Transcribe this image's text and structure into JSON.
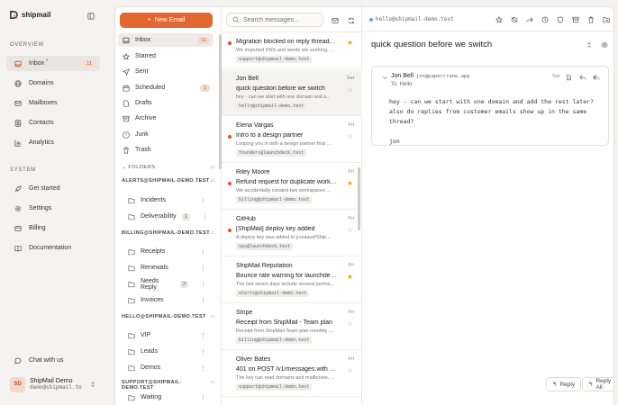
{
  "app": {
    "name": "shipmail"
  },
  "nav": {
    "overview_label": "OVERVIEW",
    "items": [
      {
        "label": "Inbox",
        "badge": "11",
        "dot": "•"
      },
      {
        "label": "Domains"
      },
      {
        "label": "Mailboxes"
      },
      {
        "label": "Contacts"
      },
      {
        "label": "Analytics"
      }
    ],
    "system_label": "SYSTEM",
    "system_items": [
      {
        "label": "Get started"
      },
      {
        "label": "Settings"
      },
      {
        "label": "Billing"
      },
      {
        "label": "Documentation"
      }
    ],
    "whats_new": "Chat with us",
    "account": {
      "initials": "SD",
      "name": "ShipMail Demo",
      "email": "demo@shipmail.to"
    }
  },
  "folders": {
    "new_email": "New Email",
    "system": [
      {
        "label": "Inbox",
        "badge": "11"
      },
      {
        "label": "Starred"
      },
      {
        "label": "Sent"
      },
      {
        "label": "Scheduled",
        "badge": "1"
      },
      {
        "label": "Drafts"
      },
      {
        "label": "Archive"
      },
      {
        "label": "Junk"
      },
      {
        "label": "Trash"
      }
    ],
    "folders_label": "FOLDERS",
    "groups": [
      {
        "name": "ALERTS@SHIPMAIL-DEMO.TEST",
        "items": [
          {
            "label": "Incidents"
          },
          {
            "label": "Deliverability",
            "count": "1"
          }
        ]
      },
      {
        "name": "BILLING@SHIPMAIL-DEMO.TEST",
        "items": [
          {
            "label": "Receipts"
          },
          {
            "label": "Renewals"
          },
          {
            "label": "Needs Reply",
            "count": "2"
          },
          {
            "label": "Invoices"
          }
        ]
      },
      {
        "name": "HELLO@SHIPMAIL-DEMO.TEST",
        "items": [
          {
            "label": "VIP"
          },
          {
            "label": "Leads"
          },
          {
            "label": "Demos"
          }
        ]
      },
      {
        "name": "SUPPORT@SHIPMAIL-DEMO.TEST",
        "items": [
          {
            "label": "Waiting"
          }
        ]
      }
    ]
  },
  "list": {
    "search_placeholder": "Search messages...",
    "messages": [
      {
        "from": "",
        "date": "",
        "subject": "Migration blocked on reply threading",
        "preview": "We imported DNS and sends are working, ...",
        "tag": "support@shipmail-demo.test",
        "unread": true,
        "starred": true
      },
      {
        "from": "Jon Bell",
        "date": "Sat",
        "subject": "quick question before we switch",
        "preview": "hey - can we start with one domain and a...",
        "tag": "hello@shipmail-demo.test",
        "unread": false,
        "starred": false,
        "selected": true
      },
      {
        "from": "Elena Vargas",
        "date": "Fri",
        "subject": "Intro to a design partner",
        "preview": "Looping you in with a design partner that ...",
        "tag": "founders@launchdeck.test",
        "unread": true,
        "starred": false
      },
      {
        "from": "Riley Moore",
        "date": "Fri",
        "subject": "Refund request for duplicate workspaces",
        "preview": "We accidentally created two workspaces ...",
        "tag": "billing@shipmail-demo.test",
        "unread": true,
        "starred": true
      },
      {
        "from": "GitHub",
        "date": "Fri",
        "subject": "[ShipMail] deploy key added",
        "preview": "A deploy key was added to jcoulaud/Ship...",
        "tag": "ops@launchdeck.test",
        "unread": true,
        "starred": false
      },
      {
        "from": "ShipMail Reputation",
        "date": "Fri",
        "subject": "Bounce rate warning for launchdeck.test",
        "preview": "The last seven days include several perma...",
        "tag": "alerts@shipmail-demo.test",
        "unread": false,
        "starred": true
      },
      {
        "from": "Stripe",
        "date": "Fri",
        "subject": "Receipt from ShipMail - Team plan",
        "preview": "Receipt from ShipMail Team plan monthly ...",
        "tag": "billing@shipmail-demo.test",
        "unread": false,
        "starred": false
      },
      {
        "from": "Oliver Bates",
        "date": "Fri",
        "subject": "401 on POST /v1/messages.with co...",
        "preview": "The key can read domains and mailboxes, ...",
        "tag": "support@shipmail-demo.test",
        "unread": false,
        "starred": false
      }
    ]
  },
  "reader": {
    "mailbox": "hello@shipmail-demo.test",
    "subject": "quick question before we switch",
    "message": {
      "sender": "Jon Bell",
      "sender_email": "jon@papercrane.app",
      "to": "To: Hello",
      "date": "Sat",
      "body": "hey - can we start with one domain and add the rest later?\nalso do replies from customer emails show up in the same\nthread?\n\njon"
    },
    "reply": "Reply",
    "reply_all": "Reply All"
  },
  "colors": {
    "accent": "#e1662f",
    "star": "#e6a91a",
    "unread": "#e0502a"
  }
}
